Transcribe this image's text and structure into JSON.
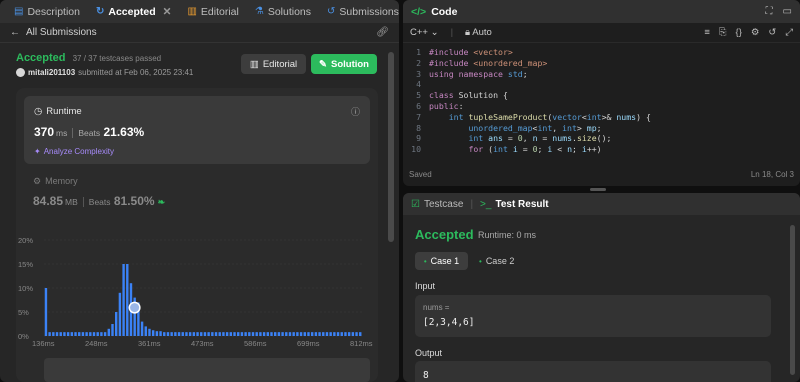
{
  "tabs": {
    "description": "Description",
    "accepted": "Accepted",
    "editorial": "Editorial",
    "solutions": "Solutions",
    "submissions": "Submissions"
  },
  "breadcrumb": {
    "back_label": "All Submissions"
  },
  "submission": {
    "status": "Accepted",
    "passed": "37 / 37 testcases passed",
    "user": "mitali201103",
    "submitted_text": "submitted at Feb 06, 2025 23:41",
    "editorial_button": "Editorial",
    "solution_button": "Solution"
  },
  "runtime": {
    "label": "Runtime",
    "value": "370",
    "unit": "ms",
    "beats_label": "Beats",
    "beats_value": "21.63%",
    "analyze": "Analyze Complexity"
  },
  "memory": {
    "label": "Memory",
    "value": "84.85",
    "unit": "MB",
    "beats_label": "Beats",
    "beats_value": "81.50%"
  },
  "chart_data": {
    "type": "bar",
    "y_ticks": [
      "0%",
      "5%",
      "10%",
      "15%",
      "20%"
    ],
    "ylim": [
      0,
      20
    ],
    "x_ticks": [
      "136ms",
      "248ms",
      "361ms",
      "473ms",
      "586ms",
      "699ms",
      "812ms"
    ],
    "values": [
      10,
      0.8,
      0.8,
      0.8,
      0.8,
      0.8,
      0.8,
      0.8,
      0.8,
      0.8,
      0.8,
      0.8,
      0.8,
      0.8,
      0.8,
      0.8,
      0.8,
      1.5,
      2.5,
      5,
      9,
      15,
      15,
      11,
      8,
      7,
      3,
      2,
      1.5,
      1.2,
      1,
      1,
      0.8,
      0.8,
      0.8,
      0.8,
      0.8,
      0.8,
      0.8,
      0.8,
      0.8,
      0.8,
      0.8,
      0.8,
      0.8,
      0.8,
      0.8,
      0.8,
      0.8,
      0.8,
      0.8,
      0.8,
      0.8,
      0.8,
      0.8,
      0.8,
      0.8,
      0.8,
      0.8,
      0.8,
      0.8,
      0.8,
      0.8,
      0.8,
      0.8,
      0.8,
      0.8,
      0.8,
      0.8,
      0.8,
      0.8,
      0.8,
      0.8,
      0.8,
      0.8,
      0.8,
      0.8,
      0.8,
      0.8,
      0.8,
      0.8,
      0.8,
      0.8,
      0.8,
      0.8,
      0.8
    ],
    "grid": true,
    "color": "#3b82f6"
  },
  "code_panel": {
    "title": "Code",
    "language": "C++",
    "mode": "Auto",
    "saved": "Saved",
    "cursor": "Ln 18, Col 3",
    "lines": [
      "#include <vector>",
      "#include <unordered_map>",
      "using namespace std;",
      "",
      "class Solution {",
      "public:",
      "    int tupleSameProduct(vector<int>& nums) {",
      "        unordered_map<int, int> mp;",
      "        int ans = 0, n = nums.size();",
      "        for (int i = 0; i < n; i++)"
    ],
    "line_numbers": [
      "1",
      "2",
      "3",
      "4",
      "5",
      "6",
      "7",
      "8",
      "9",
      "10"
    ]
  },
  "result_panel": {
    "testcase_tab": "Testcase",
    "result_tab": "Test Result",
    "status": "Accepted",
    "runtime": "Runtime: 0 ms",
    "case1": "Case 1",
    "case2": "Case 2",
    "input_label": "Input",
    "input_name": "nums =",
    "input_value": "[2,3,4,6]",
    "output_label": "Output",
    "output_value": "8"
  }
}
